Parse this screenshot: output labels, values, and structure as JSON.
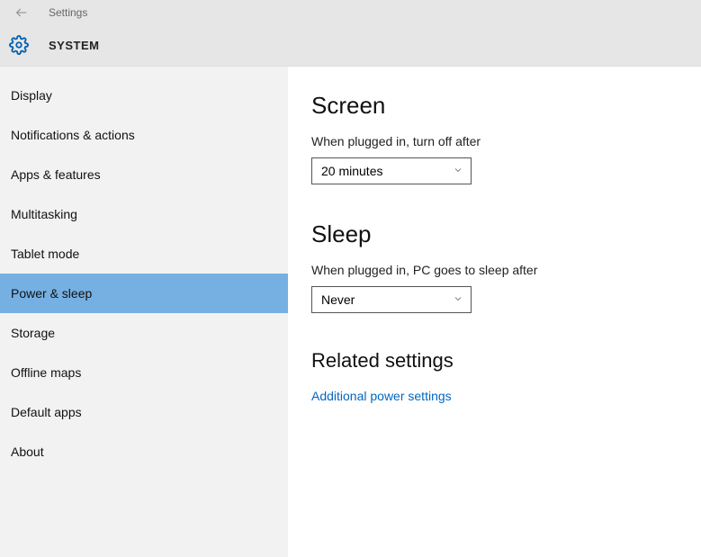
{
  "header": {
    "breadcrumb": "Settings",
    "title": "SYSTEM"
  },
  "sidebar": {
    "items": [
      {
        "label": "Display"
      },
      {
        "label": "Notifications & actions"
      },
      {
        "label": "Apps & features"
      },
      {
        "label": "Multitasking"
      },
      {
        "label": "Tablet mode"
      },
      {
        "label": "Power & sleep",
        "selected": true
      },
      {
        "label": "Storage"
      },
      {
        "label": "Offline maps"
      },
      {
        "label": "Default apps"
      },
      {
        "label": "About"
      }
    ]
  },
  "content": {
    "screen": {
      "heading": "Screen",
      "label": "When plugged in, turn off after",
      "value": "20 minutes"
    },
    "sleep": {
      "heading": "Sleep",
      "label": "When plugged in, PC goes to sleep after",
      "value": "Never"
    },
    "related": {
      "heading": "Related settings",
      "link": "Additional power settings"
    }
  }
}
